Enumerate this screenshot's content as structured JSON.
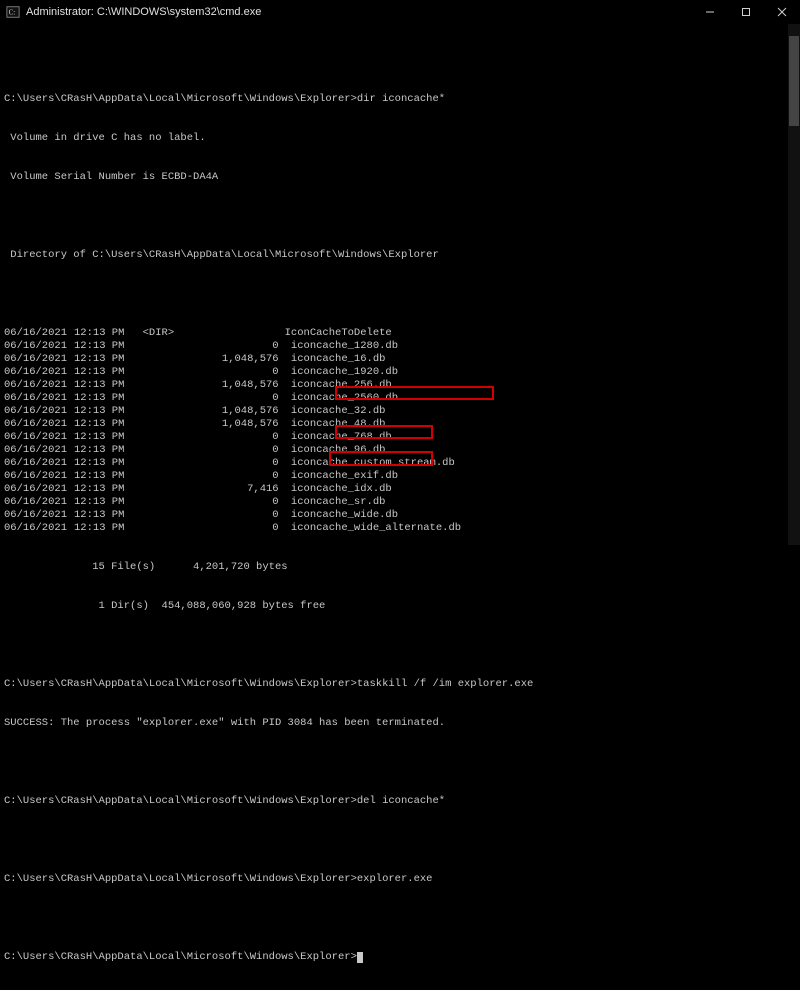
{
  "window": {
    "title": "Administrator: C:\\WINDOWS\\system32\\cmd.exe"
  },
  "prompt_path": "C:\\Users\\CRasH\\AppData\\Local\\Microsoft\\Windows\\Explorer",
  "cmd1": "dir iconcache*",
  "vol_line": " Volume in drive C has no label.",
  "serial_line": " Volume Serial Number is ECBD-DA4A",
  "dir_of_line": " Directory of C:\\Users\\CRasH\\AppData\\Local\\Microsoft\\Windows\\Explorer",
  "dir_entries": [
    {
      "date": "06/16/2021",
      "time": "12:13 PM",
      "dirtag": "<DIR>",
      "size": "",
      "name": "IconCacheToDelete"
    },
    {
      "date": "06/16/2021",
      "time": "12:13 PM",
      "dirtag": "",
      "size": "0",
      "name": "iconcache_1280.db"
    },
    {
      "date": "06/16/2021",
      "time": "12:13 PM",
      "dirtag": "",
      "size": "1,048,576",
      "name": "iconcache_16.db"
    },
    {
      "date": "06/16/2021",
      "time": "12:13 PM",
      "dirtag": "",
      "size": "0",
      "name": "iconcache_1920.db"
    },
    {
      "date": "06/16/2021",
      "time": "12:13 PM",
      "dirtag": "",
      "size": "1,048,576",
      "name": "iconcache_256.db"
    },
    {
      "date": "06/16/2021",
      "time": "12:13 PM",
      "dirtag": "",
      "size": "0",
      "name": "iconcache_2560.db"
    },
    {
      "date": "06/16/2021",
      "time": "12:13 PM",
      "dirtag": "",
      "size": "1,048,576",
      "name": "iconcache_32.db"
    },
    {
      "date": "06/16/2021",
      "time": "12:13 PM",
      "dirtag": "",
      "size": "1,048,576",
      "name": "iconcache_48.db"
    },
    {
      "date": "06/16/2021",
      "time": "12:13 PM",
      "dirtag": "",
      "size": "0",
      "name": "iconcache_768.db"
    },
    {
      "date": "06/16/2021",
      "time": "12:13 PM",
      "dirtag": "",
      "size": "0",
      "name": "iconcache_96.db"
    },
    {
      "date": "06/16/2021",
      "time": "12:13 PM",
      "dirtag": "",
      "size": "0",
      "name": "iconcache_custom_stream.db"
    },
    {
      "date": "06/16/2021",
      "time": "12:13 PM",
      "dirtag": "",
      "size": "0",
      "name": "iconcache_exif.db"
    },
    {
      "date": "06/16/2021",
      "time": "12:13 PM",
      "dirtag": "",
      "size": "7,416",
      "name": "iconcache_idx.db"
    },
    {
      "date": "06/16/2021",
      "time": "12:13 PM",
      "dirtag": "",
      "size": "0",
      "name": "iconcache_sr.db"
    },
    {
      "date": "06/16/2021",
      "time": "12:13 PM",
      "dirtag": "",
      "size": "0",
      "name": "iconcache_wide.db"
    },
    {
      "date": "06/16/2021",
      "time": "12:13 PM",
      "dirtag": "",
      "size": "0",
      "name": "iconcache_wide_alternate.db"
    }
  ],
  "summary_files": "              15 File(s)      4,201,720 bytes",
  "summary_dirs": "               1 Dir(s)  454,088,060,928 bytes free",
  "cmd2": "taskkill /f /im explorer.exe",
  "cmd2_result": "SUCCESS: The process \"explorer.exe\" with PID 3084 has been terminated.",
  "cmd3": "del iconcache*",
  "cmd4_prompt_short": "C:\\Users\\CRasH\\AppData\\Local\\Microsoft\\Windows\\Explore",
  "cmd4": "r>explorer.exe",
  "final_prompt_suffix": ">"
}
